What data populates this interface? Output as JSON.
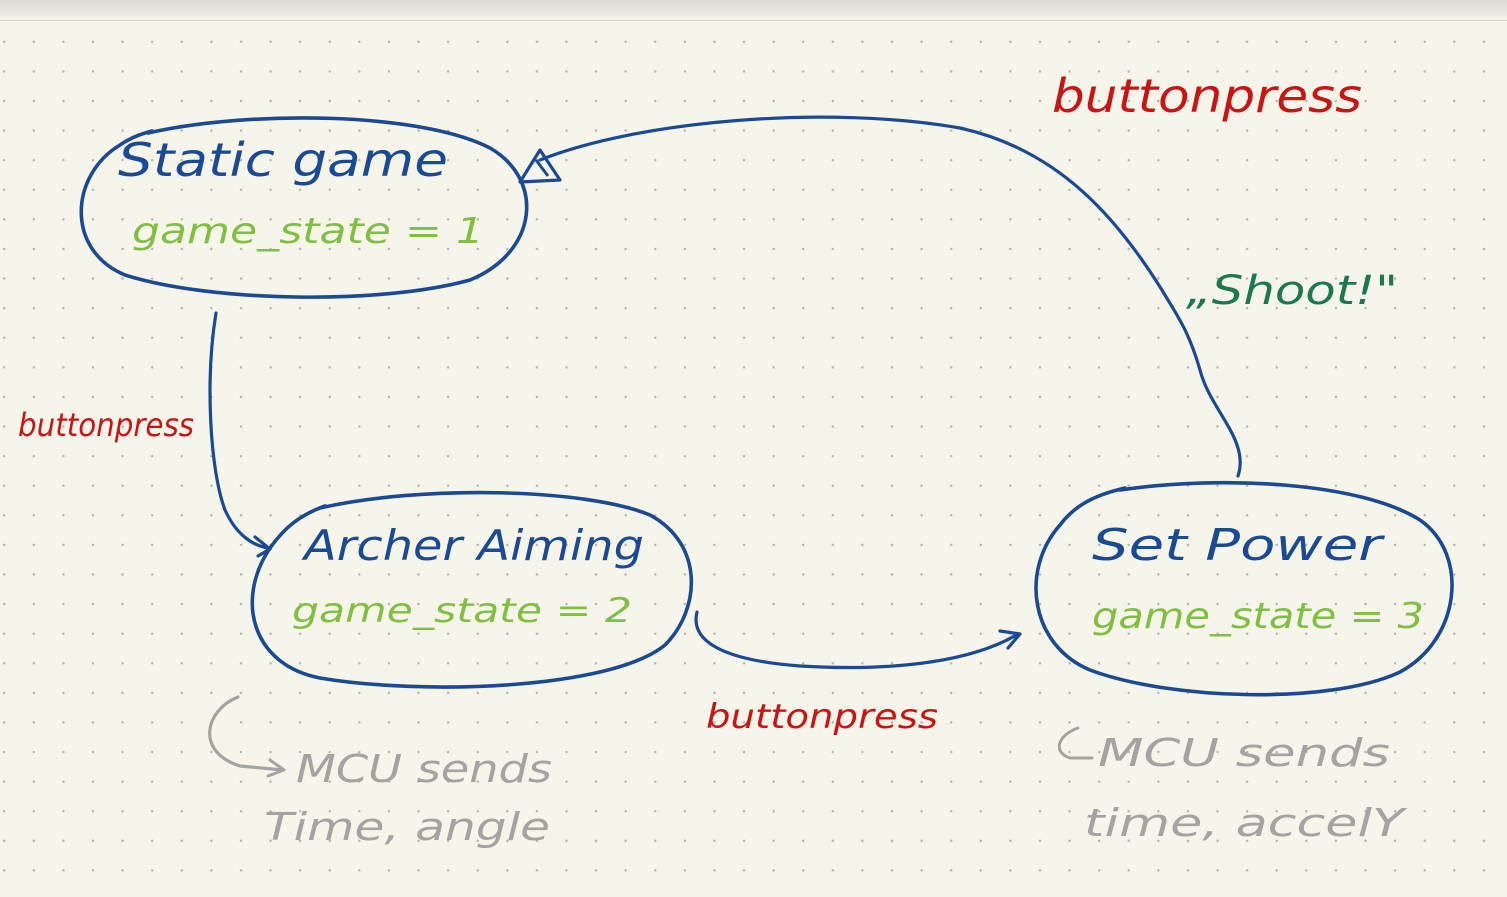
{
  "colors": {
    "outline": "#1a4a94",
    "state_name": "#1a4a94",
    "state_var": "#7fc043",
    "event": "#c81414",
    "action": "#1a7a4e",
    "note": "#a3a3a3"
  },
  "states": [
    {
      "title": "Static game",
      "var": "game_state = 1"
    },
    {
      "title": "Archer Aiming",
      "var": "game_state = 2"
    },
    {
      "title": "Set Power",
      "var": "game_state = 3"
    }
  ],
  "transitions": [
    {
      "event": "buttonpress"
    },
    {
      "event": "buttonpress"
    },
    {
      "event": "buttonpress",
      "action": "„Shoot!\""
    }
  ],
  "notes": [
    {
      "line1": "MCU sends",
      "line2": "Time, angle"
    },
    {
      "line1": "MCU sends",
      "line2": "time, accelY"
    }
  ]
}
